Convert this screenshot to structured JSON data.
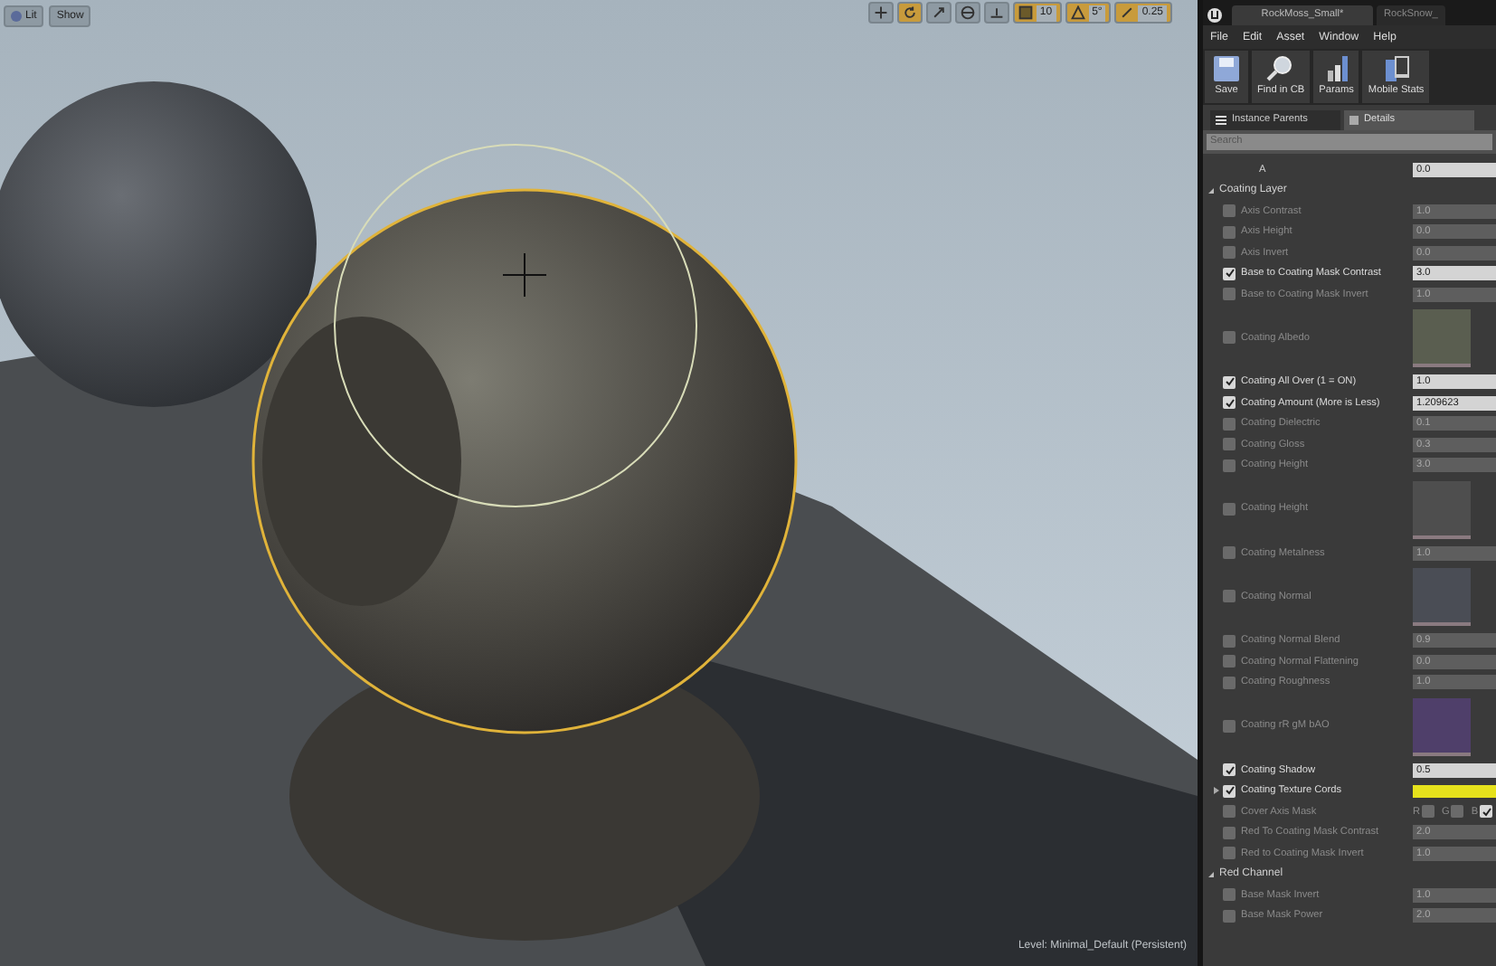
{
  "viewport": {
    "buttons": [
      "Lit",
      "Show"
    ],
    "tools": [
      {
        "kind": "move",
        "selected": false
      },
      {
        "kind": "rotate",
        "selected": true
      },
      {
        "kind": "scale",
        "selected": false
      },
      {
        "kind": "globe",
        "selected": false
      },
      {
        "kind": "surface",
        "selected": false
      },
      {
        "kind": "grid",
        "selected": true,
        "value": "10"
      },
      {
        "kind": "angle",
        "selected": true,
        "value": "5°"
      },
      {
        "kind": "scalesnap",
        "selected": true,
        "value": "0.25"
      }
    ],
    "level_label": "Level:  Minimal_Default (Persistent)"
  },
  "editor": {
    "tabs": [
      {
        "label": "RockMoss_Small*",
        "selected": true
      },
      {
        "label": "RockSnow_",
        "selected": false
      }
    ],
    "menu": [
      "File",
      "Edit",
      "Asset",
      "Window",
      "Help"
    ],
    "toolbar": [
      {
        "kind": "save",
        "label": "Save"
      },
      {
        "kind": "find",
        "label": "Find in CB"
      },
      {
        "kind": "params",
        "label": "Params"
      },
      {
        "kind": "stats",
        "label": "Mobile Stats"
      }
    ],
    "panel_tabs": [
      {
        "label": "Instance Parents",
        "selected": false
      },
      {
        "label": "Details",
        "selected": true
      }
    ],
    "search": {
      "placeholder": "Search"
    },
    "rows": [
      {
        "kind": "plain",
        "label": "A",
        "value": "0.0"
      },
      {
        "kind": "group",
        "label": "Coating Layer"
      },
      {
        "kind": "scalar",
        "label": "Axis Contrast",
        "checked": false,
        "value": "1.0"
      },
      {
        "kind": "scalar",
        "label": "Axis Height",
        "checked": false,
        "value": "0.0"
      },
      {
        "kind": "scalar",
        "label": "Axis Invert",
        "checked": false,
        "value": "0.0"
      },
      {
        "kind": "scalar",
        "label": "Base to Coating Mask Contrast",
        "checked": true,
        "value": "3.0"
      },
      {
        "kind": "scalar",
        "label": "Base to Coating Mask Invert",
        "checked": false,
        "value": "1.0"
      },
      {
        "kind": "texture",
        "label": "Coating Albedo",
        "checked": false,
        "color": "#5a5e50"
      },
      {
        "kind": "scalar",
        "label": "Coating All Over (1 = ON)",
        "checked": true,
        "value": "1.0"
      },
      {
        "kind": "scalar",
        "label": "Coating Amount (More is Less)",
        "checked": true,
        "value": "1.209623"
      },
      {
        "kind": "scalar",
        "label": "Coating Dielectric",
        "checked": false,
        "value": "0.1"
      },
      {
        "kind": "scalar",
        "label": "Coating Gloss",
        "checked": false,
        "value": "0.3"
      },
      {
        "kind": "scalar",
        "label": "Coating Height",
        "checked": false,
        "value": "3.0"
      },
      {
        "kind": "texture",
        "label": "Coating Height",
        "checked": false,
        "color": "#4e4e4e"
      },
      {
        "kind": "scalar",
        "label": "Coating Metalness",
        "checked": false,
        "value": "1.0"
      },
      {
        "kind": "texture",
        "label": "Coating Normal",
        "checked": false,
        "color": "#4a4d55"
      },
      {
        "kind": "scalar",
        "label": "Coating Normal Blend",
        "checked": false,
        "value": "0.9"
      },
      {
        "kind": "scalar",
        "label": "Coating Normal Flattening",
        "checked": false,
        "value": "0.0"
      },
      {
        "kind": "scalar",
        "label": "Coating Roughness",
        "checked": false,
        "value": "1.0"
      },
      {
        "kind": "texture",
        "label": "Coating rR gM bAO",
        "checked": false,
        "color": "#4f3f6a"
      },
      {
        "kind": "scalar",
        "label": "Coating Shadow",
        "checked": true,
        "value": "0.5"
      },
      {
        "kind": "vector",
        "label": "Coating Texture Cords",
        "checked": true,
        "color": "#e6e21c"
      },
      {
        "kind": "mask",
        "label": "Cover Axis Mask",
        "checked": false,
        "channels": [
          {
            "label": "R",
            "checked": false
          },
          {
            "label": "G",
            "checked": false
          },
          {
            "label": "B",
            "checked": true
          }
        ]
      },
      {
        "kind": "scalar",
        "label": "Red To Coating Mask Contrast",
        "checked": false,
        "value": "2.0"
      },
      {
        "kind": "scalar",
        "label": "Red to Coating Mask Invert",
        "checked": false,
        "value": "1.0"
      },
      {
        "kind": "group",
        "label": "Red Channel"
      },
      {
        "kind": "scalar",
        "label": "Base Mask Invert",
        "checked": false,
        "value": "1.0"
      },
      {
        "kind": "scalar",
        "label": "Base Mask Power",
        "checked": false,
        "value": "2.0"
      }
    ]
  }
}
